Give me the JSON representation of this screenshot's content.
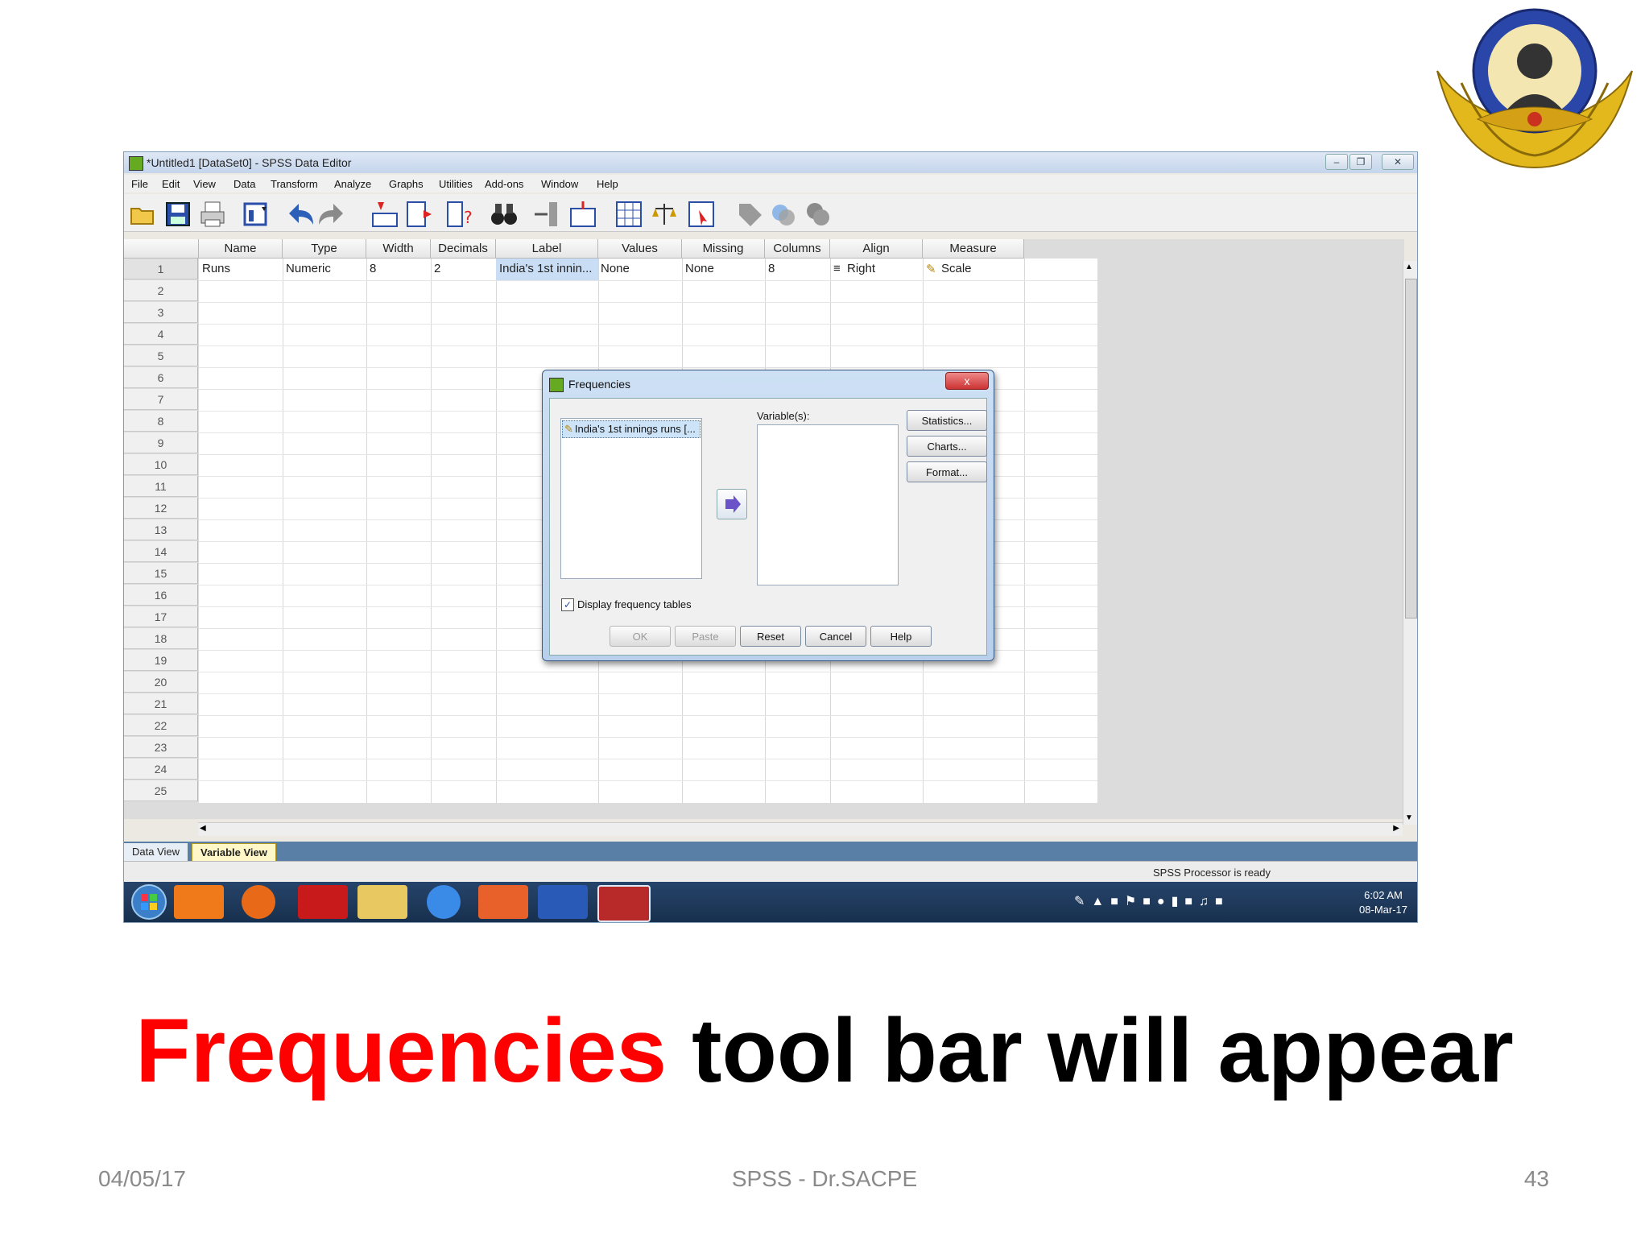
{
  "window": {
    "title": "*Untitled1 [DataSet0] - SPSS Data Editor",
    "menus": [
      "File",
      "Edit",
      "View",
      "Data",
      "Transform",
      "Analyze",
      "Graphs",
      "Utilities",
      "Add-ons",
      "Window",
      "Help"
    ]
  },
  "toolbar": {
    "icons": [
      "open-icon",
      "save-icon",
      "print-icon",
      "dialog-recall-icon",
      "undo-icon",
      "redo-icon",
      "goto-case-icon",
      "goto-variable-icon",
      "variables-icon",
      "find-icon",
      "insert-case-icon",
      "insert-variable-icon",
      "split-file-icon",
      "weight-cases-icon",
      "select-cases-icon",
      "value-labels-icon",
      "use-sets-icon",
      "show-all-icon"
    ]
  },
  "grid": {
    "columns": [
      "Name",
      "Type",
      "Width",
      "Decimals",
      "Label",
      "Values",
      "Missing",
      "Columns",
      "Align",
      "Measure"
    ],
    "row1": [
      "Runs",
      "Numeric",
      "8",
      "2",
      "India's 1st innin...",
      "None",
      "None",
      "8",
      "Right",
      "Scale"
    ],
    "row_numbers": [
      "1",
      "2",
      "3",
      "4",
      "5",
      "6",
      "7",
      "8",
      "9",
      "10",
      "11",
      "12",
      "13",
      "14",
      "15",
      "16",
      "17",
      "18",
      "19",
      "20",
      "21",
      "22",
      "23",
      "24",
      "25"
    ]
  },
  "tabs": {
    "data_view": "Data View",
    "variable_view": "Variable View"
  },
  "status": {
    "processor": "SPSS  Processor is ready"
  },
  "taskbar": {
    "time": "6:02 AM",
    "date": "08-Mar-17"
  },
  "dialog": {
    "title": "Frequencies",
    "close": "x",
    "source_item": "India's 1st innings runs [...",
    "variables_label": "Variable(s):",
    "statistics": "Statistics...",
    "charts": "Charts...",
    "format": "Format...",
    "display_tables": "Display frequency tables",
    "display_tables_checked": true,
    "ok": "OK",
    "paste": "Paste",
    "reset": "Reset",
    "cancel": "Cancel",
    "help": "Help"
  },
  "caption": {
    "highlight": "Frequencies",
    "rest": " tool bar will appear"
  },
  "footer": {
    "date": "04/05/17",
    "center": "SPSS - Dr.SACPE",
    "page": "43"
  }
}
